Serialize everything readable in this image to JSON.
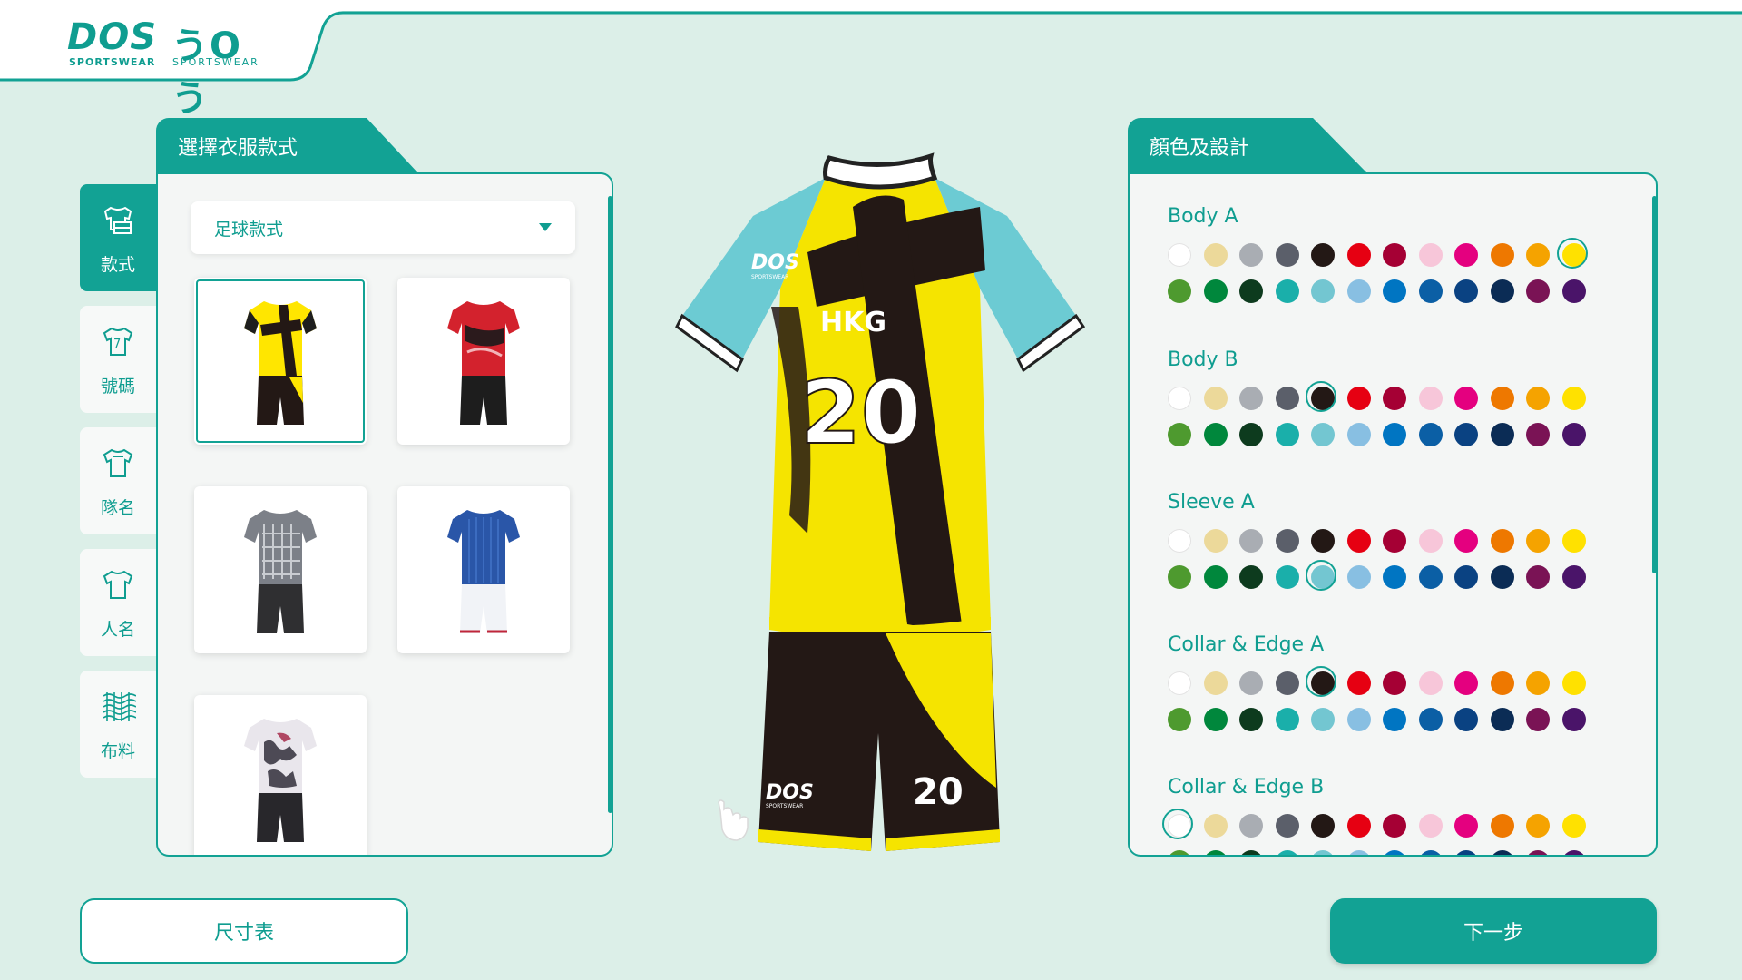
{
  "brand": {
    "logo_text": "DOS",
    "logo_sub": "SPORTSWEAR",
    "logo_alt": "うOう",
    "logo_alt_sub": "SPORTSWEAR",
    "accent": "#12a294"
  },
  "sidebar": {
    "items": [
      {
        "label": "款式",
        "icon": "jersey-style-icon",
        "active": true
      },
      {
        "label": "號碼",
        "icon": "jersey-number-icon",
        "active": false
      },
      {
        "label": "隊名",
        "icon": "jersey-team-icon",
        "active": false
      },
      {
        "label": "人名",
        "icon": "jersey-name-icon",
        "active": false
      },
      {
        "label": "布料",
        "icon": "fabric-icon",
        "active": false
      }
    ]
  },
  "style_panel": {
    "title": "選擇衣服款式",
    "dropdown_value": "足球款式",
    "items": [
      {
        "name": "yellow-black-kit",
        "selected": true
      },
      {
        "name": "red-black-kit",
        "selected": false
      },
      {
        "name": "grey-pattern-kit",
        "selected": false
      },
      {
        "name": "blue-white-kit",
        "selected": false
      },
      {
        "name": "white-camo-kit",
        "selected": false
      }
    ]
  },
  "preview": {
    "team_name": "HKG",
    "number": "20",
    "shorts_number": "20",
    "brand_mark": "DOS",
    "brand_sub": "SPORTSWEAR"
  },
  "color_panel": {
    "title": "顏色及設計",
    "palette": [
      "#ffffff",
      "#ecd99a",
      "#a9adb3",
      "#5b5f6a",
      "#231815",
      "#e60012",
      "#a50034",
      "#f7c6d9",
      "#e4007f",
      "#ee7800",
      "#f5a300",
      "#ffe100",
      "#4e9a2f",
      "#00873c",
      "#0d3b1e",
      "#1aafaa",
      "#73c6d1",
      "#88bfe2",
      "#0075c2",
      "#0b5fa5",
      "#0a4282",
      "#0b2c55",
      "#7a1355",
      "#4a1469"
    ],
    "groups": [
      {
        "label": "Body A",
        "selected": 11
      },
      {
        "label": "Body B",
        "selected": 4
      },
      {
        "label": "Sleeve A",
        "selected": 16
      },
      {
        "label": "Collar & Edge A",
        "selected": 4
      },
      {
        "label": "Collar & Edge B",
        "selected": 0
      }
    ]
  },
  "buttons": {
    "size_chart": "尺寸表",
    "next": "下一步"
  }
}
